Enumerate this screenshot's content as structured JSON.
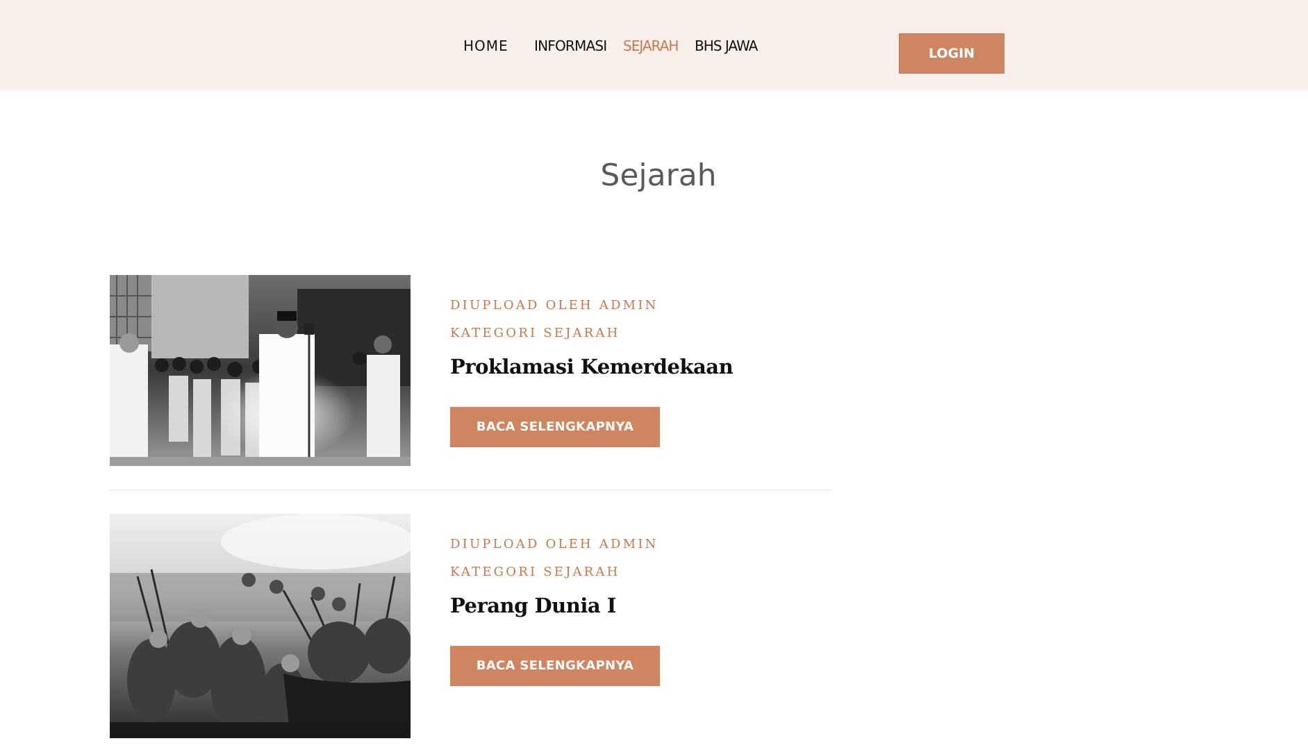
{
  "nav": {
    "items": [
      {
        "label": "HOME"
      },
      {
        "label": "INFORMASI"
      },
      {
        "label": "SEJARAH",
        "active": true
      },
      {
        "label": "BHS JAWA"
      }
    ],
    "login_label": "LOGIN"
  },
  "page": {
    "title": "Sejarah"
  },
  "posts": [
    {
      "author": "DIUPLOAD OLEH ADMIN",
      "category": "KATEGORI SEJARAH",
      "title": "Proklamasi Kemerdekaan",
      "button_label": "BACA SELENGKAPNYA"
    },
    {
      "author": "DIUPLOAD OLEH ADMIN",
      "category": "KATEGORI SEJARAH",
      "title": "Perang Dunia I",
      "button_label": "BACA SELENGKAPNYA"
    }
  ],
  "colors": {
    "accent": "#d08562",
    "accent_text": "#c27a52",
    "header_bg": "#f8efeb",
    "title_gray": "#5a5a5a"
  }
}
